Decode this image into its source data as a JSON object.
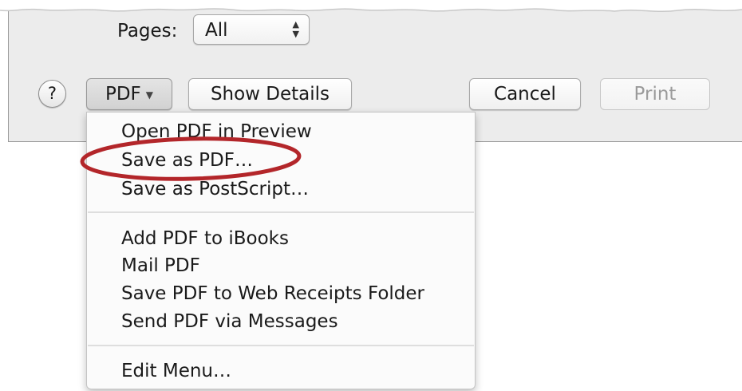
{
  "dialog": {
    "pages_label": "Pages:",
    "pages_value": "All",
    "help_label": "?",
    "pdf_button_label": "PDF",
    "show_details_label": "Show Details",
    "cancel_label": "Cancel",
    "print_label": "Print"
  },
  "pdf_menu": {
    "groups": [
      [
        "Open PDF in Preview",
        "Save as PDF…",
        "Save as PostScript…"
      ],
      [
        "Add PDF to iBooks",
        "Mail PDF",
        "Save PDF to Web Receipts Folder",
        "Send PDF via Messages"
      ],
      [
        "Edit Menu…"
      ]
    ],
    "highlighted_item": "Save as PDF…"
  },
  "colors": {
    "sheet_bg": "#ececec",
    "menu_bg": "#fbfbfb",
    "highlight_ring": "#b3262a",
    "disabled_text": "#9a9a9a"
  },
  "icons": {
    "pdf_caret": "triangle-down-icon",
    "pages_stepper": "up-down-arrows-icon",
    "highlight": "red-ellipse-annotation"
  }
}
